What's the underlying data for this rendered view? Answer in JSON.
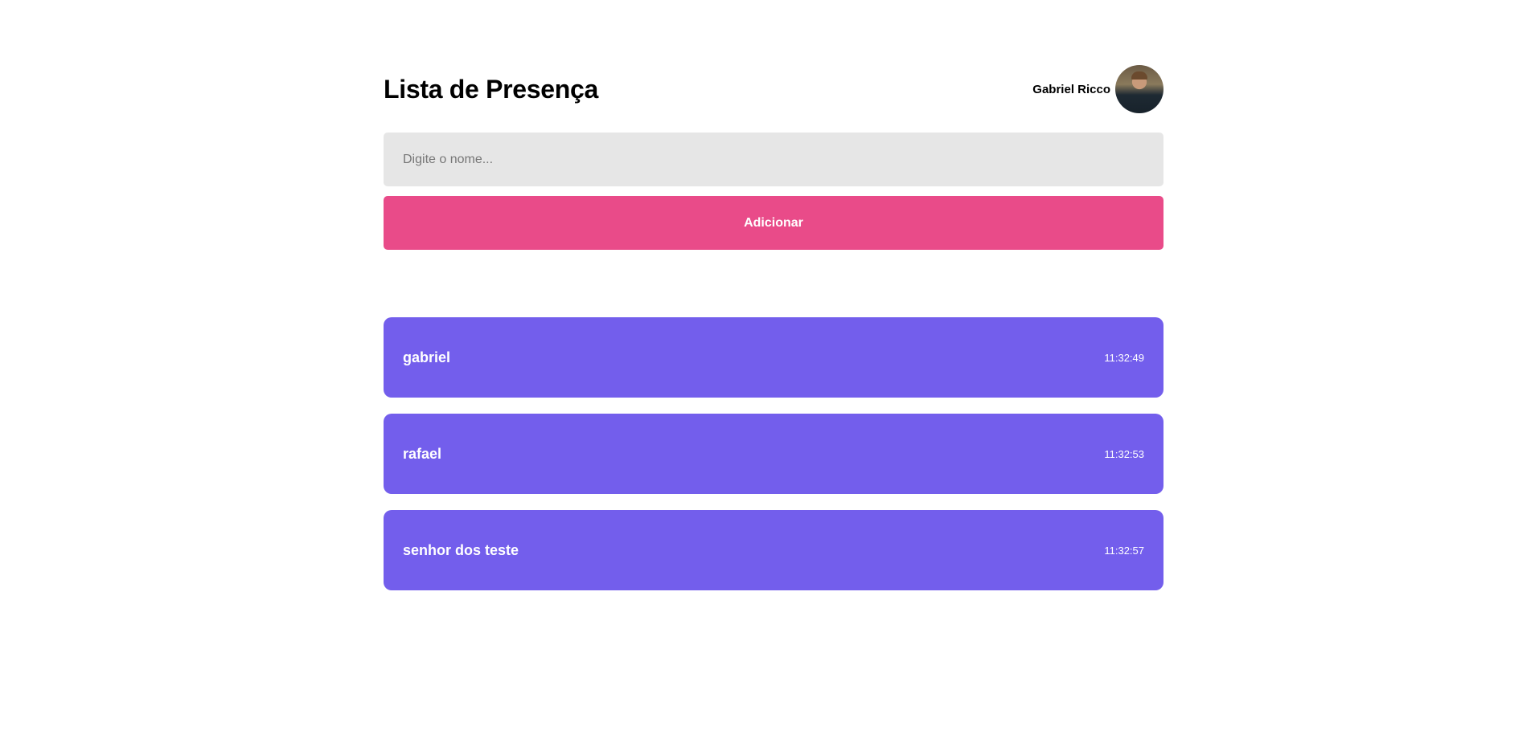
{
  "header": {
    "title": "Lista de Presença",
    "user_name": "Gabriel Ricco",
    "avatar_icon": "user-photo"
  },
  "form": {
    "input_value": "",
    "input_placeholder": "Digite o nome...",
    "add_label": "Adicionar"
  },
  "colors": {
    "accent": "#E94B89",
    "card": "#735EEC",
    "input_bg": "#E6E6E6"
  },
  "attendees": [
    {
      "name": "gabriel",
      "time": "11:32:49"
    },
    {
      "name": "rafael",
      "time": "11:32:53"
    },
    {
      "name": "senhor dos teste",
      "time": "11:32:57"
    }
  ]
}
